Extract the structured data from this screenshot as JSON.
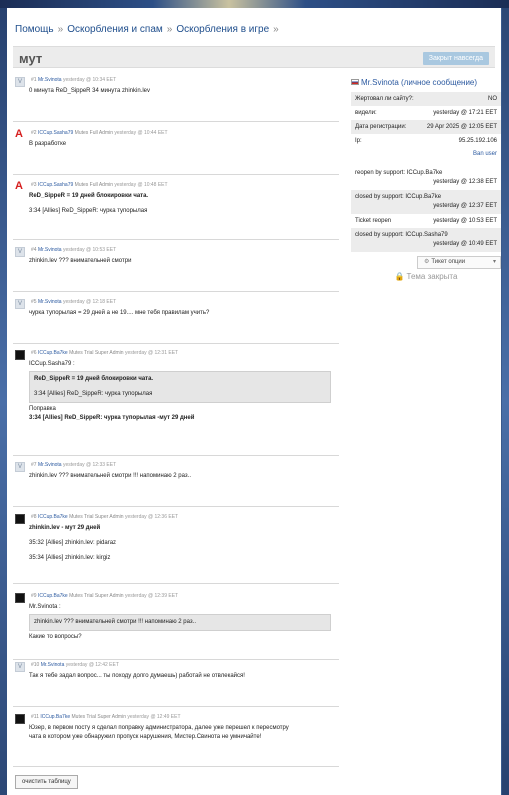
{
  "breadcrumb": {
    "items": [
      "Помощь",
      "Оскорбления и спам",
      "Оскорбления в игре"
    ],
    "separator": "»"
  },
  "thread": {
    "title": "мут",
    "closed_button": "Закрыт навсегда"
  },
  "messages": [
    {
      "num": "#1",
      "user": "Mr.Svinota",
      "role": "",
      "time": "yesterday @ 10:34 EET",
      "text": "0 минута ReD_SippeR 34 минута zhinkin.lev"
    },
    {
      "num": "#2",
      "user": "ICCup.Sasha79",
      "role": "Mutes Full Admin",
      "time": "yesterday @ 10:44 EET",
      "text": "В разработке"
    },
    {
      "num": "#3",
      "user": "ICCup.Sasha79",
      "role": "Mutes Full Admin",
      "time": "yesterday @ 10:48 EET",
      "line1": "ReD_SippeR = 19 дней блокировки чата.",
      "line2": "3:34 [Allies] ReD_SippeR: чурка тупорылая"
    },
    {
      "num": "#4",
      "user": "Mr.Svinota",
      "role": "",
      "time": "yesterday @ 10:53 EET",
      "text": "zhinkin.lev ??? внимательней смотри"
    },
    {
      "num": "#5",
      "user": "Mr.Svinota",
      "role": "",
      "time": "yesterday @ 12:18 EET",
      "text": "чурка тупорылая = 29 дней а не 19.... мне тебя правилам учить?"
    },
    {
      "num": "#6",
      "user": "ICCup.Ba7ke",
      "role": "Mutes Trial Super Admin",
      "time": "yesterday @ 12:31 EET",
      "quote_author": "ICCup.Sasha79 :",
      "quote_line1": "ReD_SippeR = 19 дней блокировки чата.",
      "quote_line2": "3:34 [Allies] ReD_SippeR: чурка тупорылая",
      "line1": "Поправка",
      "line2": "3:34 [Allies] ReD_SippeR: чурка тупорылая -мут 29 дней"
    },
    {
      "num": "#7",
      "user": "Mr.Svinota",
      "role": "",
      "time": "yesterday @ 12:33 EET",
      "text": "zhinkin.lev ??? внимательней смотри !!! напоминаю 2 раз.."
    },
    {
      "num": "#8",
      "user": "ICCup.Ba7ke",
      "role": "Mutes Trial Super Admin",
      "time": "yesterday @ 12:36 EET",
      "line1": "zhinkin.lev - мут 29 дней",
      "line2": "35:32 [Allies] zhinkin.lev: pidaraz",
      "line3": "35:34 [Allies] zhinkin.lev: kirgiz"
    },
    {
      "num": "#9",
      "user": "ICCup.Ba7ke",
      "role": "Mutes Trial Super Admin",
      "time": "yesterday @ 12:39 EET",
      "quote_author": "Mr.Svinota :",
      "quote_line1": "zhinkin.lev ??? внимательней смотри !!! напоминаю 2 раз..",
      "text": "Какие то вопросы?"
    },
    {
      "num": "#10",
      "user": "Mr.Svinota",
      "role": "",
      "time": "yesterday @ 12:42 EET",
      "text": "Так я тебе задал вопрос... ты походу долго думаешь) работай не отвлекайся!"
    },
    {
      "num": "#11",
      "user": "ICCup.Ba7ke",
      "role": "Mutes Trial Super Admin",
      "time": "yesterday @ 12:49 EET",
      "line1": "Юзер, в первом посту я сделал поправку администратора, далее уже перешел к пересмотру",
      "line2": "чата в котором уже обнаружил пропуск нарушения, Мистер.Свинота не умничайте!"
    }
  ],
  "info": {
    "header": "Mr.Svinota (личное сообщение)",
    "rows": [
      {
        "label": "Жертовал ли сайту?:",
        "value": "NO"
      },
      {
        "label": "видели:",
        "value": "yesterday @ 17:21 EET"
      },
      {
        "label": "Дата регистрации:",
        "value": "29 Apr 2025 @ 12:05 EET"
      },
      {
        "label": "Ip:",
        "value": "95.25.192.106"
      }
    ],
    "ban_user": "Ban user"
  },
  "actions": [
    {
      "text": "reopen by support: ICCup.Ba7ke",
      "at": "yesterday @ 12:38 EET"
    },
    {
      "text": "closed by support: ICCup.Ba7ke",
      "at": "yesterday @ 12:37 EET"
    },
    {
      "text": "Ticket reopen",
      "at": "yesterday @ 10:53 EET"
    },
    {
      "text": "closed by support: ICCup.Sasha79",
      "at": "yesterday @ 10:49 EET"
    }
  ],
  "options_button": "Тикет опции",
  "closed_label": "Тема закрыта",
  "clear_button": "очистить таблицу",
  "colors": {
    "link": "#2c5aa0",
    "closed_button": "#a9c8e0",
    "flag_red": "#d52b1e"
  }
}
